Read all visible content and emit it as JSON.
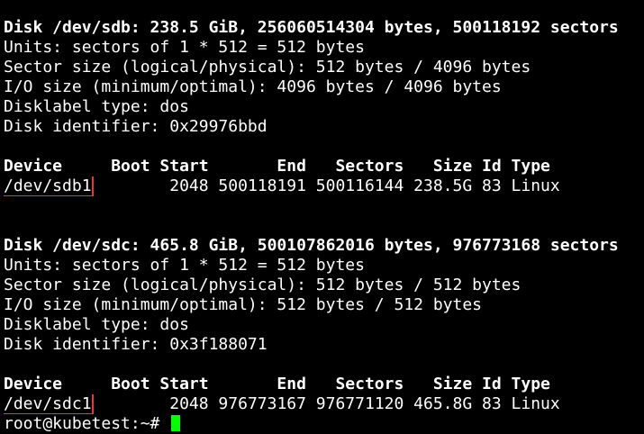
{
  "colors": {
    "background": "#000000",
    "text": "#ffffff",
    "highlight_box": "#e03a3a",
    "cursor": "#00ff00"
  },
  "disk1": {
    "header": "Disk /dev/sdb: 238.5 GiB, 256060514304 bytes, 500118192 sectors",
    "units": "Units: sectors of 1 * 512 = 512 bytes",
    "sector_size": "Sector size (logical/physical): 512 bytes / 4096 bytes",
    "io_size": "I/O size (minimum/optimal): 4096 bytes / 4096 bytes",
    "label_type": "Disklabel type: dos",
    "identifier": "Disk identifier: 0x29976bbd",
    "table_header": "Device     Boot Start       End   Sectors   Size Id Type",
    "device": "/dev/sdb1",
    "row_rest": "        2048 500118191 500116144 238.5G 83 Linux"
  },
  "disk2": {
    "header": "Disk /dev/sdc: 465.8 GiB, 500107862016 bytes, 976773168 sectors",
    "units": "Units: sectors of 1 * 512 = 512 bytes",
    "sector_size": "Sector size (logical/physical): 512 bytes / 512 bytes",
    "io_size": "I/O size (minimum/optimal): 512 bytes / 512 bytes",
    "label_type": "Disklabel type: dos",
    "identifier": "Disk identifier: 0x3f188071",
    "table_header": "Device     Boot Start       End   Sectors   Size Id Type",
    "device": "/dev/sdc1",
    "row_rest": "        2048 976773167 976771120 465.8G 83 Linux"
  },
  "prompt": {
    "text": "root@kubetest:~# "
  }
}
